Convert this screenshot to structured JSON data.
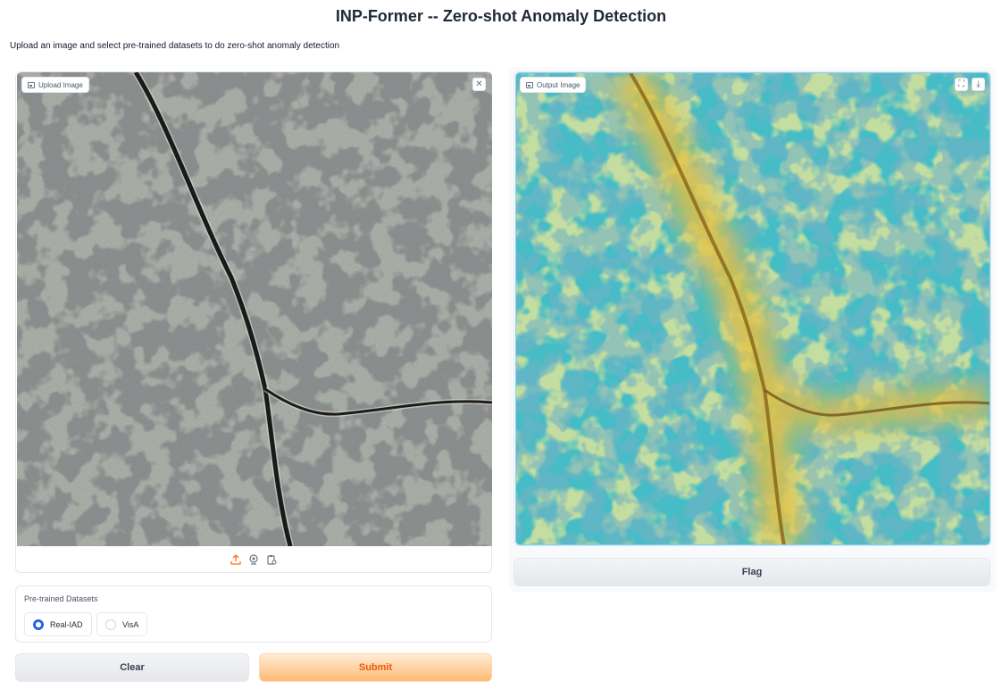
{
  "header": {
    "title": "INP-Former -- Zero-shot Anomaly Detection",
    "description": "Upload an image and select pre-trained datasets to do zero-shot anomaly detection"
  },
  "upload": {
    "label": "Upload Image",
    "label_icon": "image-icon",
    "clear_icon": "close-icon",
    "clear_glyph": "✕",
    "sources": [
      "upload-icon",
      "webcam-icon",
      "clipboard-icon"
    ]
  },
  "datasets": {
    "label": "Pre-trained Datasets",
    "options": [
      "Real-IAD",
      "VisA"
    ],
    "selected": "Real-IAD"
  },
  "buttons": {
    "clear": "Clear",
    "submit": "Submit",
    "flag": "Flag"
  },
  "output": {
    "label": "Output Image",
    "label_icon": "image-icon",
    "fullscreen_icon": "fullscreen-icon",
    "fullscreen_glyph": "⛶",
    "download_icon": "download-icon",
    "download_glyph": "⤓"
  },
  "colors": {
    "accent": "#2563eb",
    "submit_text": "#ea580c",
    "submit_bg": "#fdba74",
    "heatmap_low": "#3fb8c2",
    "heatmap_high": "#e6c23a"
  }
}
